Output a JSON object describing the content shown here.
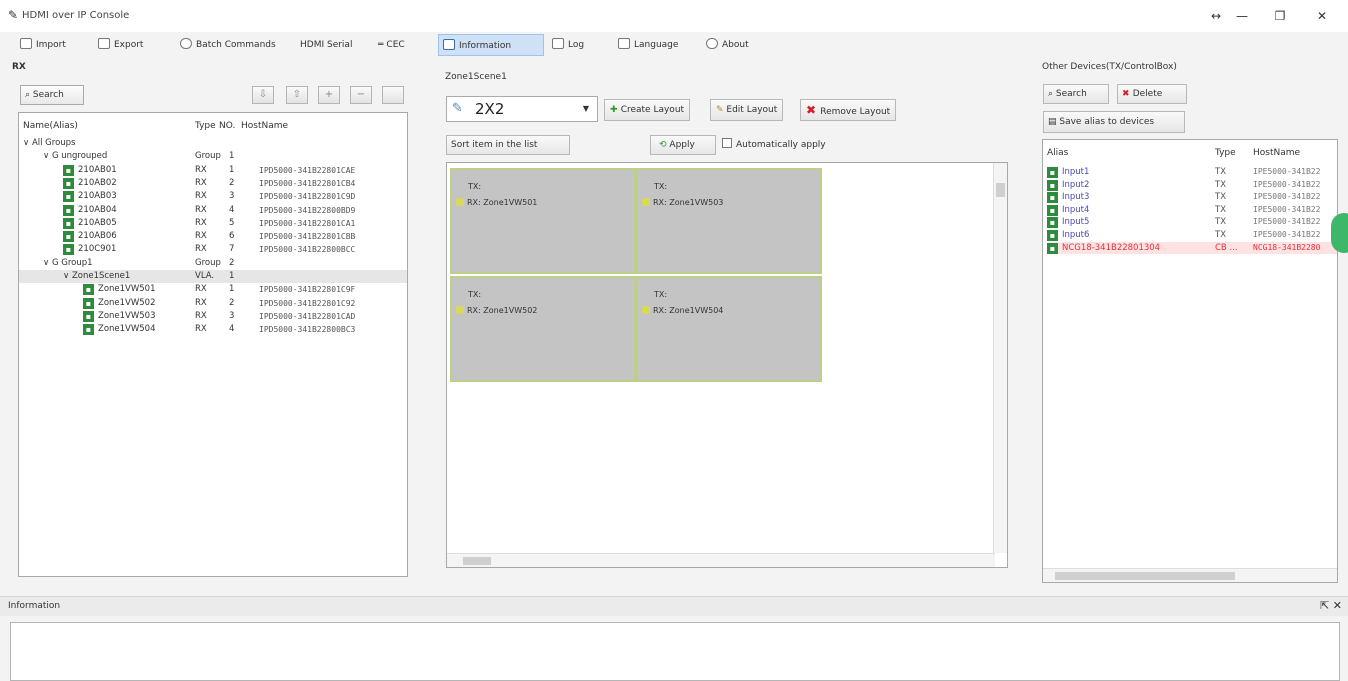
{
  "window": {
    "title": "HDMI over IP Console",
    "controls": [
      "↔",
      "—",
      "❐",
      "✕"
    ]
  },
  "toolbar": {
    "items": [
      {
        "label": "Import",
        "icon": "import-icon"
      },
      {
        "label": "Export",
        "icon": "export-icon"
      },
      {
        "label": "Batch Commands",
        "icon": "batch-icon"
      },
      {
        "label": "HDMI Serial",
        "icon": "serial-icon"
      },
      {
        "label": "CEC",
        "icon": "cec-icon"
      },
      {
        "label": "Information",
        "icon": "info-icon"
      },
      {
        "label": "Log",
        "icon": "log-icon"
      },
      {
        "label": "Language",
        "icon": "language-icon"
      },
      {
        "label": "About",
        "icon": "about-icon"
      }
    ]
  },
  "left": {
    "heading": "RX",
    "search_label": "Search",
    "buttons": [
      "⇩",
      "⇧",
      "+",
      "−",
      ""
    ],
    "columns": [
      "Name(Alias)",
      "Type",
      "NO.",
      "HostName"
    ],
    "rows": [
      {
        "indent": 0,
        "name": "All Groups",
        "type": "",
        "no": "",
        "host": "",
        "icon": false,
        "expander": "∨"
      },
      {
        "indent": 1,
        "name": "G  ungrouped",
        "type": "Group",
        "no": "1",
        "host": "",
        "icon": false,
        "expander": "∨"
      },
      {
        "indent": 2,
        "name": "210AB01",
        "type": "RX",
        "no": "1",
        "host": "IPD5000-341B22801CAE",
        "icon": true
      },
      {
        "indent": 2,
        "name": "210AB02",
        "type": "RX",
        "no": "2",
        "host": "IPD5000-341B22801CB4",
        "icon": true
      },
      {
        "indent": 2,
        "name": "210AB03",
        "type": "RX",
        "no": "3",
        "host": "IPD5000-341B22801C9D",
        "icon": true
      },
      {
        "indent": 2,
        "name": "210AB04",
        "type": "RX",
        "no": "4",
        "host": "IPD5000-341B22800BD9",
        "icon": true
      },
      {
        "indent": 2,
        "name": "210AB05",
        "type": "RX",
        "no": "5",
        "host": "IPD5000-341B22801CA1",
        "icon": true
      },
      {
        "indent": 2,
        "name": "210AB06",
        "type": "RX",
        "no": "6",
        "host": "IPD5000-341B22801CBB",
        "icon": true
      },
      {
        "indent": 2,
        "name": "210C901",
        "type": "RX",
        "no": "7",
        "host": "IPD5000-341B22800BCC",
        "icon": true
      },
      {
        "indent": 1,
        "name": "G  Group1",
        "type": "Group",
        "no": "2",
        "host": "",
        "icon": false,
        "expander": "∨"
      },
      {
        "indent": 2,
        "name": "Zone1Scene1",
        "type": "VLA.",
        "no": "1",
        "host": "",
        "icon": false,
        "expander": "∨",
        "selected": true
      },
      {
        "indent": 3,
        "name": "Zone1VW501",
        "type": "RX",
        "no": "1",
        "host": "IPD5000-341B22801C9F",
        "icon": true
      },
      {
        "indent": 3,
        "name": "Zone1VW502",
        "type": "RX",
        "no": "2",
        "host": "IPD5000-341B22801C92",
        "icon": true
      },
      {
        "indent": 3,
        "name": "Zone1VW503",
        "type": "RX",
        "no": "3",
        "host": "IPD5000-341B22801CAD",
        "icon": true
      },
      {
        "indent": 3,
        "name": "Zone1VW504",
        "type": "RX",
        "no": "4",
        "host": "IPD5000-341B22800BC3",
        "icon": true
      }
    ]
  },
  "center": {
    "heading": "Zone1Scene1",
    "layout_value": "2X2",
    "create_layout": "Create Layout",
    "edit_layout": "Edit Layout",
    "remove_layout": "Remove Layout",
    "sort_label": "Sort item in the list",
    "apply_label": "Apply",
    "auto_apply_label": "Automatically apply",
    "zones": [
      {
        "tx": "TX:",
        "rx": "RX: Zone1VW501"
      },
      {
        "tx": "TX:",
        "rx": "RX: Zone1VW503"
      },
      {
        "tx": "TX:",
        "rx": "RX: Zone1VW502"
      },
      {
        "tx": "TX:",
        "rx": "RX: Zone1VW504"
      }
    ]
  },
  "right": {
    "heading": "Other Devices(TX/ControlBox)",
    "search_label": "Search",
    "delete_label": "Delete",
    "save_alias_label": "Save alias to devices",
    "columns": [
      "Alias",
      "Type",
      "HostName"
    ],
    "rows": [
      {
        "alias": "Input1",
        "type": "TX",
        "host": "IPE5000-341B22",
        "red": false
      },
      {
        "alias": "Input2",
        "type": "TX",
        "host": "IPE5000-341B22",
        "red": false
      },
      {
        "alias": "Input3",
        "type": "TX",
        "host": "IPE5000-341B22",
        "red": false
      },
      {
        "alias": "Input4",
        "type": "TX",
        "host": "IPE5000-341B22",
        "red": false
      },
      {
        "alias": "Input5",
        "type": "TX",
        "host": "IPE5000-341B22",
        "red": false
      },
      {
        "alias": "Input6",
        "type": "TX",
        "host": "IPE5000-341B22",
        "red": false
      },
      {
        "alias": "NCG18-341B22801304",
        "type": "CB ...",
        "host": "NCG18-341B2280",
        "red": true
      }
    ]
  },
  "info": {
    "title": "Information",
    "controls": "⇱ ✕"
  },
  "colors": {
    "accent": "#cfe1f6",
    "zone_fill": "#c4c4c4",
    "zone_border": "#bcd08a",
    "device_green": "#2e8b3e",
    "error_red": "#e0303a"
  }
}
